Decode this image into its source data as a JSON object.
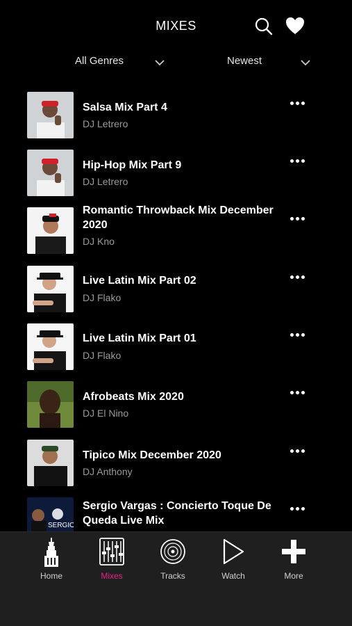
{
  "header": {
    "title": "MIXES",
    "search_icon": "search-icon",
    "favorites_icon": "heart-icon"
  },
  "filters": {
    "genre": "All Genres",
    "sort": "Newest"
  },
  "mixes": [
    {
      "title": "Salsa Mix Part 4",
      "dj": "DJ Letrero",
      "thumb": "dj-letrero-photo"
    },
    {
      "title": "Hip-Hop Mix Part 9",
      "dj": "DJ Letrero",
      "thumb": "dj-letrero-photo"
    },
    {
      "title": "Romantic Throwback Mix December 2020",
      "dj": "DJ Kno",
      "thumb": "dj-kno-photo"
    },
    {
      "title": "Live Latin Mix Part 02",
      "dj": "DJ Flako",
      "thumb": "dj-flako-photo"
    },
    {
      "title": "Live Latin Mix Part 01",
      "dj": "DJ Flako",
      "thumb": "dj-flako-photo"
    },
    {
      "title": "Afrobeats Mix 2020",
      "dj": "DJ El Nino",
      "thumb": "dj-el-nino-photo"
    },
    {
      "title": "Tipico Mix December 2020",
      "dj": "DJ Anthony",
      "thumb": "dj-anthony-photo"
    },
    {
      "title": "Sergio Vargas : Concierto Toque De Queda Live Mix",
      "dj": "",
      "thumb": "sergio-vargas-photo",
      "thumb_text": "SERGIO"
    }
  ],
  "tabs": [
    {
      "label": "Home",
      "icon": "building-icon",
      "active": false
    },
    {
      "label": "Mixes",
      "icon": "mixer-icon",
      "active": true
    },
    {
      "label": "Tracks",
      "icon": "vinyl-icon",
      "active": false
    },
    {
      "label": "Watch",
      "icon": "play-icon",
      "active": false
    },
    {
      "label": "More",
      "icon": "plus-icon",
      "active": false
    }
  ],
  "colors": {
    "background": "#000000",
    "tabbar": "#1f1f1f",
    "accent": "#e8208a",
    "subtitle": "#9a9a9a"
  }
}
